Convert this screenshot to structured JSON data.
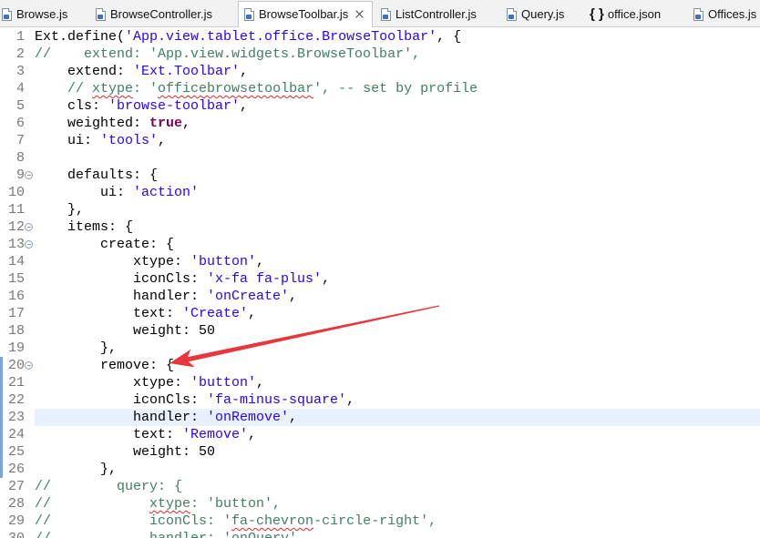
{
  "tabs": [
    {
      "label": "Browse.js",
      "icon": "js-file-icon"
    },
    {
      "label": "BrowseController.js",
      "icon": "js-file-icon"
    },
    {
      "label": "BrowseToolbar.js",
      "icon": "js-file-icon",
      "active": true,
      "close_icon": "close-icon"
    },
    {
      "label": "ListController.js",
      "icon": "js-file-icon"
    },
    {
      "label": "Query.js",
      "icon": "js-file-icon"
    },
    {
      "label": "office.json",
      "icon": "json-file-icon",
      "icon_glyph": "{ }"
    },
    {
      "label": "Offices.js",
      "icon": "js-file-icon"
    }
  ],
  "editor": {
    "current_line": 23,
    "fold_lines": [
      9,
      12,
      13,
      20
    ],
    "range_lines": [
      20,
      26
    ],
    "lines": [
      {
        "n": 1,
        "tokens": [
          {
            "text": "Ext.define("
          },
          {
            "string": "'App.view.tablet.office.BrowseToolbar'"
          },
          {
            "text": ", {"
          }
        ]
      },
      {
        "n": 2,
        "tokens": [
          {
            "comment": "//    extend: 'App.view.widgets.BrowseToolbar',"
          }
        ]
      },
      {
        "n": 3,
        "tokens": [
          {
            "text": "    extend: "
          },
          {
            "string": "'Ext.Toolbar'"
          },
          {
            "text": ","
          }
        ]
      },
      {
        "n": 4,
        "tokens": [
          {
            "comment": "    // "
          },
          {
            "comment": "xtype",
            "misspelled": true
          },
          {
            "comment": ": '"
          },
          {
            "comment": "officebrowsetoolbar",
            "misspelled": true
          },
          {
            "comment": "', -- set by profile"
          }
        ]
      },
      {
        "n": 5,
        "tokens": [
          {
            "text": "    cls: "
          },
          {
            "string": "'browse-toolbar'"
          },
          {
            "text": ","
          }
        ]
      },
      {
        "n": 6,
        "tokens": [
          {
            "text": "    weighted: "
          },
          {
            "keyword": "true"
          },
          {
            "text": ","
          }
        ]
      },
      {
        "n": 7,
        "tokens": [
          {
            "text": "    ui: "
          },
          {
            "string": "'tools'"
          },
          {
            "text": ","
          }
        ]
      },
      {
        "n": 8,
        "tokens": []
      },
      {
        "n": 9,
        "tokens": [
          {
            "text": "    defaults: {"
          }
        ]
      },
      {
        "n": 10,
        "tokens": [
          {
            "text": "        ui: "
          },
          {
            "string": "'action'"
          }
        ]
      },
      {
        "n": 11,
        "tokens": [
          {
            "text": "    },"
          }
        ]
      },
      {
        "n": 12,
        "tokens": [
          {
            "text": "    items: {"
          }
        ]
      },
      {
        "n": 13,
        "tokens": [
          {
            "text": "        create: {"
          }
        ]
      },
      {
        "n": 14,
        "tokens": [
          {
            "text": "            xtype: "
          },
          {
            "string": "'button'"
          },
          {
            "text": ","
          }
        ]
      },
      {
        "n": 15,
        "tokens": [
          {
            "text": "            iconCls: "
          },
          {
            "string": "'x-fa fa-plus'"
          },
          {
            "text": ","
          }
        ]
      },
      {
        "n": 16,
        "tokens": [
          {
            "text": "            handler: "
          },
          {
            "string": "'onCreate'"
          },
          {
            "text": ","
          }
        ]
      },
      {
        "n": 17,
        "tokens": [
          {
            "text": "            text: "
          },
          {
            "string": "'Create'"
          },
          {
            "text": ","
          }
        ]
      },
      {
        "n": 18,
        "tokens": [
          {
            "text": "            weight: 50"
          }
        ]
      },
      {
        "n": 19,
        "tokens": [
          {
            "text": "        },"
          }
        ]
      },
      {
        "n": 20,
        "tokens": [
          {
            "text": "        remove: {"
          }
        ]
      },
      {
        "n": 21,
        "tokens": [
          {
            "text": "            xtype: "
          },
          {
            "string": "'button'"
          },
          {
            "text": ","
          }
        ]
      },
      {
        "n": 22,
        "tokens": [
          {
            "text": "            iconCls: "
          },
          {
            "string": "'fa-minus-square'"
          },
          {
            "text": ","
          }
        ]
      },
      {
        "n": 23,
        "tokens": [
          {
            "text": "            handler: "
          },
          {
            "string": "'onRemove'"
          },
          {
            "text": ","
          }
        ]
      },
      {
        "n": 24,
        "tokens": [
          {
            "text": "            text: "
          },
          {
            "string": "'Remove'"
          },
          {
            "text": ","
          }
        ]
      },
      {
        "n": 25,
        "tokens": [
          {
            "text": "            weight: 50"
          }
        ]
      },
      {
        "n": 26,
        "tokens": [
          {
            "text": "        },"
          }
        ]
      },
      {
        "n": 27,
        "tokens": [
          {
            "comment": "//        query: {"
          }
        ]
      },
      {
        "n": 28,
        "tokens": [
          {
            "comment": "//            "
          },
          {
            "comment": "xtype",
            "misspelled": true
          },
          {
            "comment": ": 'button',"
          }
        ]
      },
      {
        "n": 29,
        "tokens": [
          {
            "comment": "//            iconCls: '"
          },
          {
            "comment": "fa-chevron",
            "misspelled": true
          },
          {
            "comment": "-circle-right',"
          }
        ]
      },
      {
        "n": 30,
        "tokens": [
          {
            "comment": "//            handler: 'onQuery',"
          }
        ]
      }
    ]
  },
  "colors": {
    "comment": "#3f7f5f",
    "string": "#2a00ff",
    "keyword": "#7f0055",
    "code_text": "#000000",
    "line_number": "#787878",
    "current_line": "#e8f2fe",
    "range_indicator": "#7da6d7",
    "fold_marker": "#8c9db3",
    "spell_error": "#e0262a",
    "annotation_arrow": "#e8373c"
  },
  "annotation": {
    "icon": "red-arrow-annotation"
  }
}
